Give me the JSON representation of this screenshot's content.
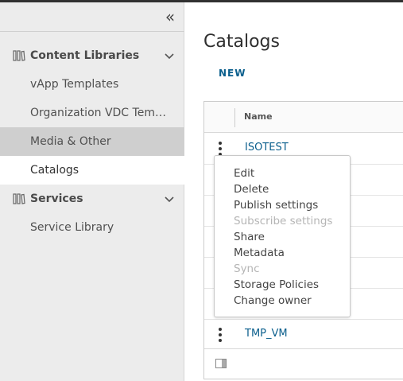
{
  "sidebar": {
    "groups": [
      {
        "label": "Content Libraries",
        "items": [
          {
            "label": "vApp Templates"
          },
          {
            "label": "Organization VDC Templates"
          },
          {
            "label": "Media & Other"
          },
          {
            "label": "Catalogs"
          }
        ]
      },
      {
        "label": "Services",
        "items": [
          {
            "label": "Service Library"
          }
        ]
      }
    ],
    "selected_item": "Catalogs",
    "highlighted_item": "Media & Other"
  },
  "main": {
    "title": "Catalogs",
    "new_button": "NEW",
    "grid": {
      "columns": [
        "Name"
      ],
      "rows": [
        {
          "name": "ISOTEST"
        },
        {
          "name": ""
        },
        {
          "name": ""
        },
        {
          "name": ""
        },
        {
          "name": ""
        },
        {
          "name": ""
        },
        {
          "name": "TMP_VM"
        }
      ]
    }
  },
  "context_menu": {
    "items": [
      {
        "label": "Edit",
        "enabled": true
      },
      {
        "label": "Delete",
        "enabled": true
      },
      {
        "label": "Publish settings",
        "enabled": true
      },
      {
        "label": "Subscribe settings",
        "enabled": false
      },
      {
        "label": "Share",
        "enabled": true
      },
      {
        "label": "Metadata",
        "enabled": true
      },
      {
        "label": "Sync",
        "enabled": false
      },
      {
        "label": "Storage Policies",
        "enabled": true
      },
      {
        "label": "Change owner",
        "enabled": true
      }
    ]
  },
  "colors": {
    "link": "#0b5f8d",
    "sidebar_bg": "#ececec",
    "sidebar_highlight": "#cfcfcf",
    "disabled_text": "#b5b5b5"
  }
}
